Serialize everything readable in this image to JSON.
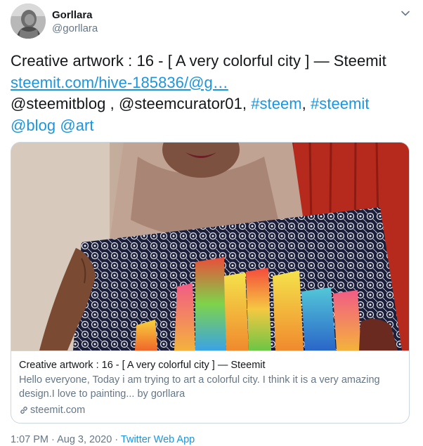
{
  "author": {
    "display_name": "Gorllara",
    "handle": "@gorllara",
    "avatar_icon": "user-avatar"
  },
  "menu_icon": "chevron-down-icon",
  "tweet": {
    "line1": "Creative artwork : 16 - [ A very colorful city ] — Steemit",
    "url": "steemit.com/hive-185836/@g…",
    "mention1": "@steemitblog",
    "sep1": " , ",
    "mention2": "@steemcurator01",
    "sep2": ", ",
    "hashtag1": "#steem",
    "sep3": ", ",
    "hashtag2": "#steemit",
    "mention3": "@blog",
    "sep4": " ",
    "mention4": "@art"
  },
  "card": {
    "image_icon": "artwork-photo",
    "title": "Creative artwork : 16 - [ A very colorful city ] — Steemit",
    "description": "Hello everyone, Today i am trying to art a colorful city. I think it is a very amazing design.I love to painting... by gorllara",
    "domain": "steemit.com"
  },
  "footer": {
    "timestamp": "1:07 PM · Aug 3, 2020",
    "separator": " · ",
    "source": "Twitter Web App"
  },
  "colors": {
    "link": "#1b95e0",
    "text": "#14171a",
    "secondary": "#657786",
    "border": "#ccd6dd"
  }
}
